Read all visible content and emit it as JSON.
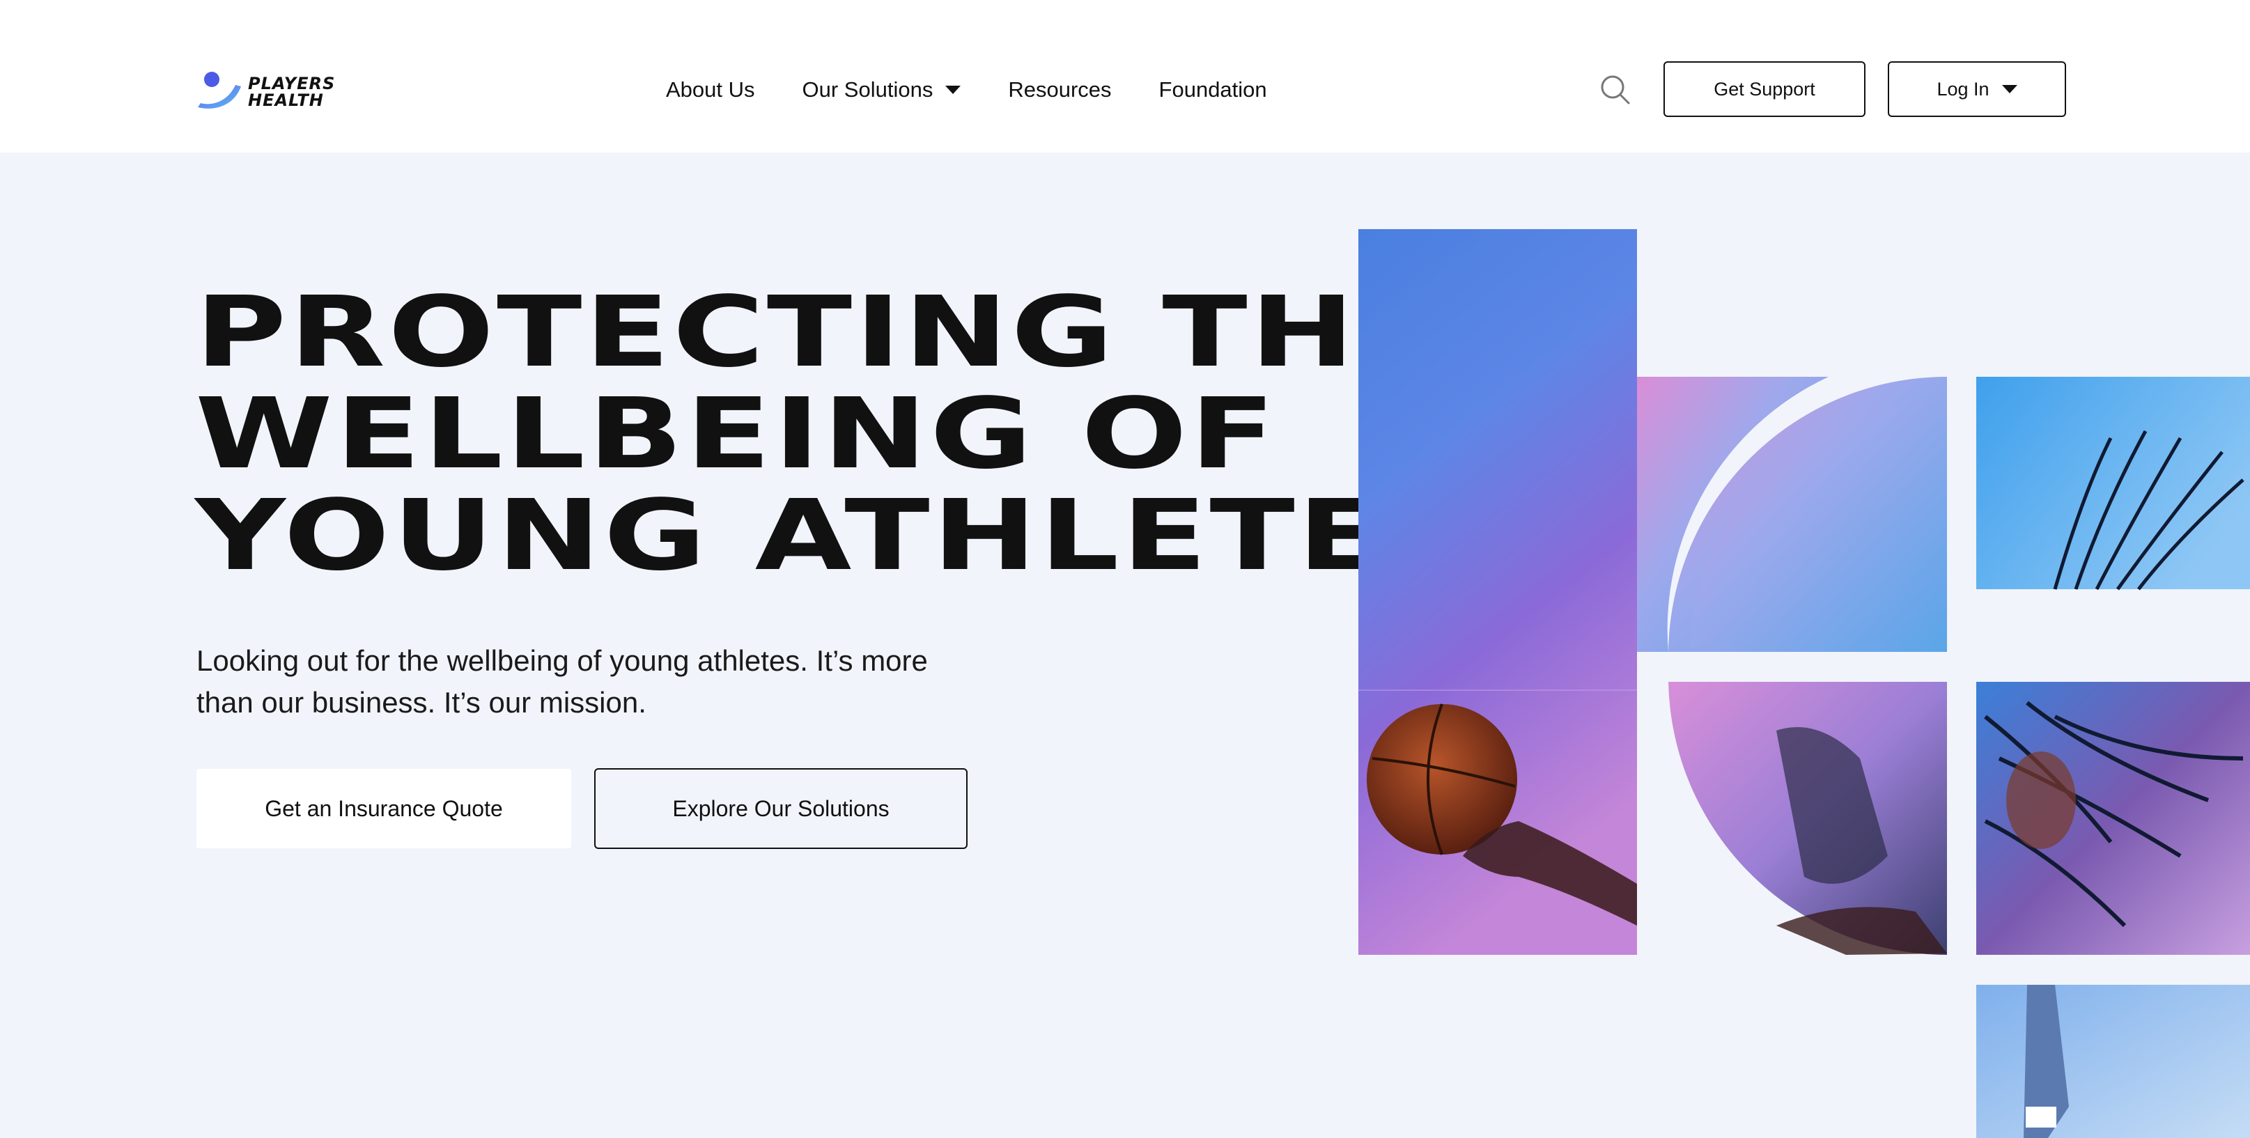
{
  "brand": {
    "line1": "PLAYERS",
    "line2": "HEALTH",
    "accent_start": "#5b6ef0",
    "accent_end": "#5fb6f0"
  },
  "nav": {
    "items": [
      {
        "label": "About Us"
      },
      {
        "label": "Our Solutions",
        "has_dropdown": true
      },
      {
        "label": "Resources"
      },
      {
        "label": "Foundation"
      }
    ]
  },
  "header_actions": {
    "search_icon": "search-icon",
    "support_label": "Get Support",
    "login_label": "Log In"
  },
  "hero": {
    "headline_lines": [
      "PROTECTING THE",
      "WELLBEING OF",
      "YOUNG ATHLETES"
    ],
    "subtext": "Looking out for the wellbeing of young athletes. It’s more than our business. It’s our mission.",
    "primary_cta": "Get an Insurance Quote",
    "secondary_cta": "Explore Our Solutions"
  },
  "colors": {
    "hero_background": "#f1f4fa",
    "text": "#111111",
    "photo_blue": "#4a8fe0",
    "photo_purple": "#a06ad8",
    "photo_pink": "#e28ec8"
  }
}
